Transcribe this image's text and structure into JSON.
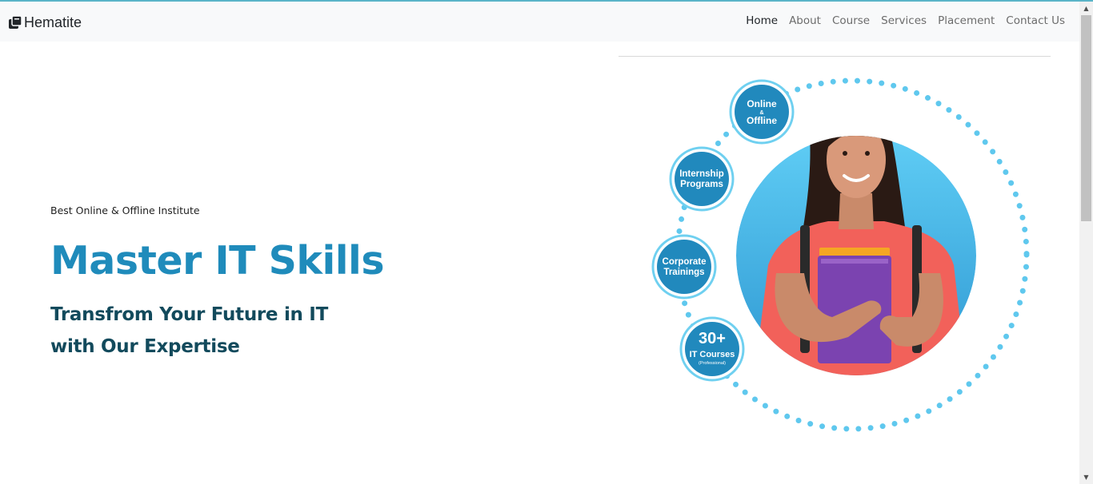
{
  "brand": {
    "name": "Hematite",
    "icon": "books-icon"
  },
  "nav": {
    "items": [
      {
        "label": "Home",
        "active": true
      },
      {
        "label": "About"
      },
      {
        "label": "Course"
      },
      {
        "label": "Services"
      },
      {
        "label": "Placement"
      },
      {
        "label": "Contact Us"
      }
    ]
  },
  "hero": {
    "tagline": "Best Online & Offline Institute",
    "title": "Master IT Skills",
    "subtitle": "Transfrom Your Future in IT with Our Expertise"
  },
  "features": {
    "online": {
      "line1": "Online",
      "amp": "&",
      "line2": "Offline"
    },
    "internship": {
      "line1": "Internship",
      "line2": "Programs"
    },
    "corporate": {
      "line1": "Corporate",
      "line2": "Trainings"
    },
    "courses": {
      "number": "30+",
      "label": "IT Courses",
      "note": "(Professional)"
    }
  },
  "colors": {
    "accent": "#1f8bbb",
    "heading_dark": "#124a5c",
    "badge_blue": "#2189bd",
    "dots": "#5fc8ee"
  }
}
